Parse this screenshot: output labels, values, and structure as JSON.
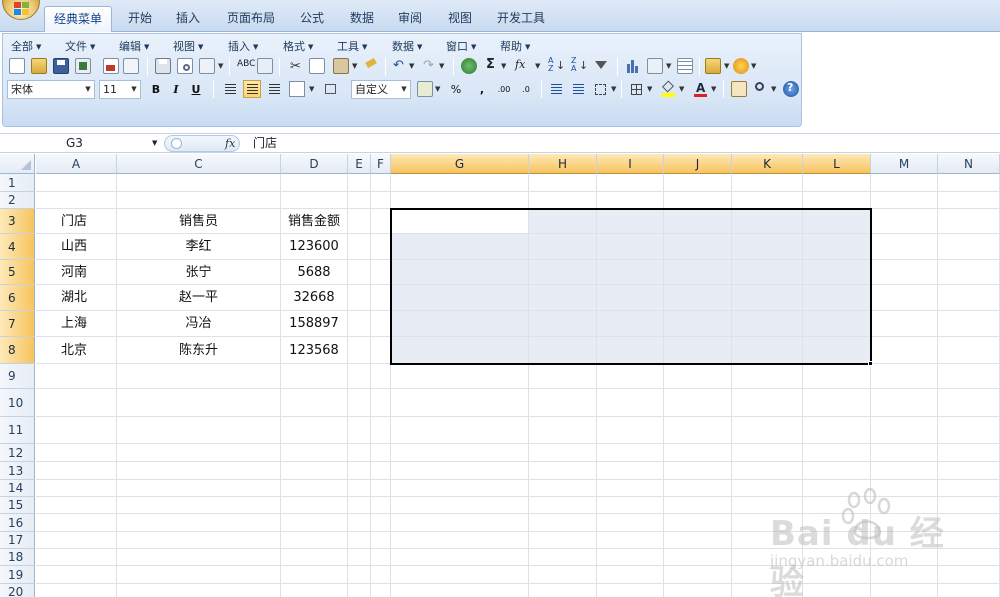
{
  "ribbon": {
    "tabs": [
      "经典菜单",
      "开始",
      "插入",
      "页面布局",
      "公式",
      "数据",
      "审阅",
      "视图",
      "开发工具"
    ],
    "active_tab": "经典菜单"
  },
  "classic_menu": {
    "items": [
      "全部",
      "文件",
      "编辑",
      "视图",
      "插入",
      "格式",
      "工具",
      "数据",
      "窗口",
      "帮助"
    ]
  },
  "toolbar": {
    "font_name": "宋体",
    "font_size": "11",
    "number_format": "自定义",
    "bold": "B",
    "italic": "I",
    "underline": "U",
    "percent": "%",
    "comma": ",",
    "sum": "Σ",
    "fx": "fx"
  },
  "formula_bar": {
    "name_box": "G3",
    "fx_label": "fx",
    "content": "门店"
  },
  "sheet": {
    "columns": [
      "A",
      "C",
      "D",
      "E",
      "F",
      "G",
      "H",
      "I",
      "J",
      "K",
      "L",
      "M",
      "N"
    ],
    "rows": [
      "1",
      "2",
      "3",
      "4",
      "5",
      "6",
      "7",
      "8",
      "9",
      "10",
      "11",
      "12",
      "13",
      "14",
      "15",
      "16",
      "17",
      "18",
      "19",
      "20"
    ],
    "selection": "G3:L8",
    "active_cell": "G3",
    "header_row": [
      "门店",
      "销售员",
      "销售金额"
    ],
    "data_rows": [
      [
        "山西",
        "李红",
        "123600"
      ],
      [
        "河南",
        "张宁",
        "5688"
      ],
      [
        "湖北",
        "赵一平",
        "32668"
      ],
      [
        "上海",
        "冯冶",
        "158897"
      ],
      [
        "北京",
        "陈东升",
        "123568"
      ]
    ]
  },
  "watermark": {
    "brand": "Bai du 经验",
    "url": "jingyan.baidu.com"
  },
  "colors": {
    "ribbon_blue": "#c9dbf0",
    "selected_header": "#f7c45d",
    "selection_fill": "#dde3ef",
    "grid_line": "#dae2ec"
  }
}
